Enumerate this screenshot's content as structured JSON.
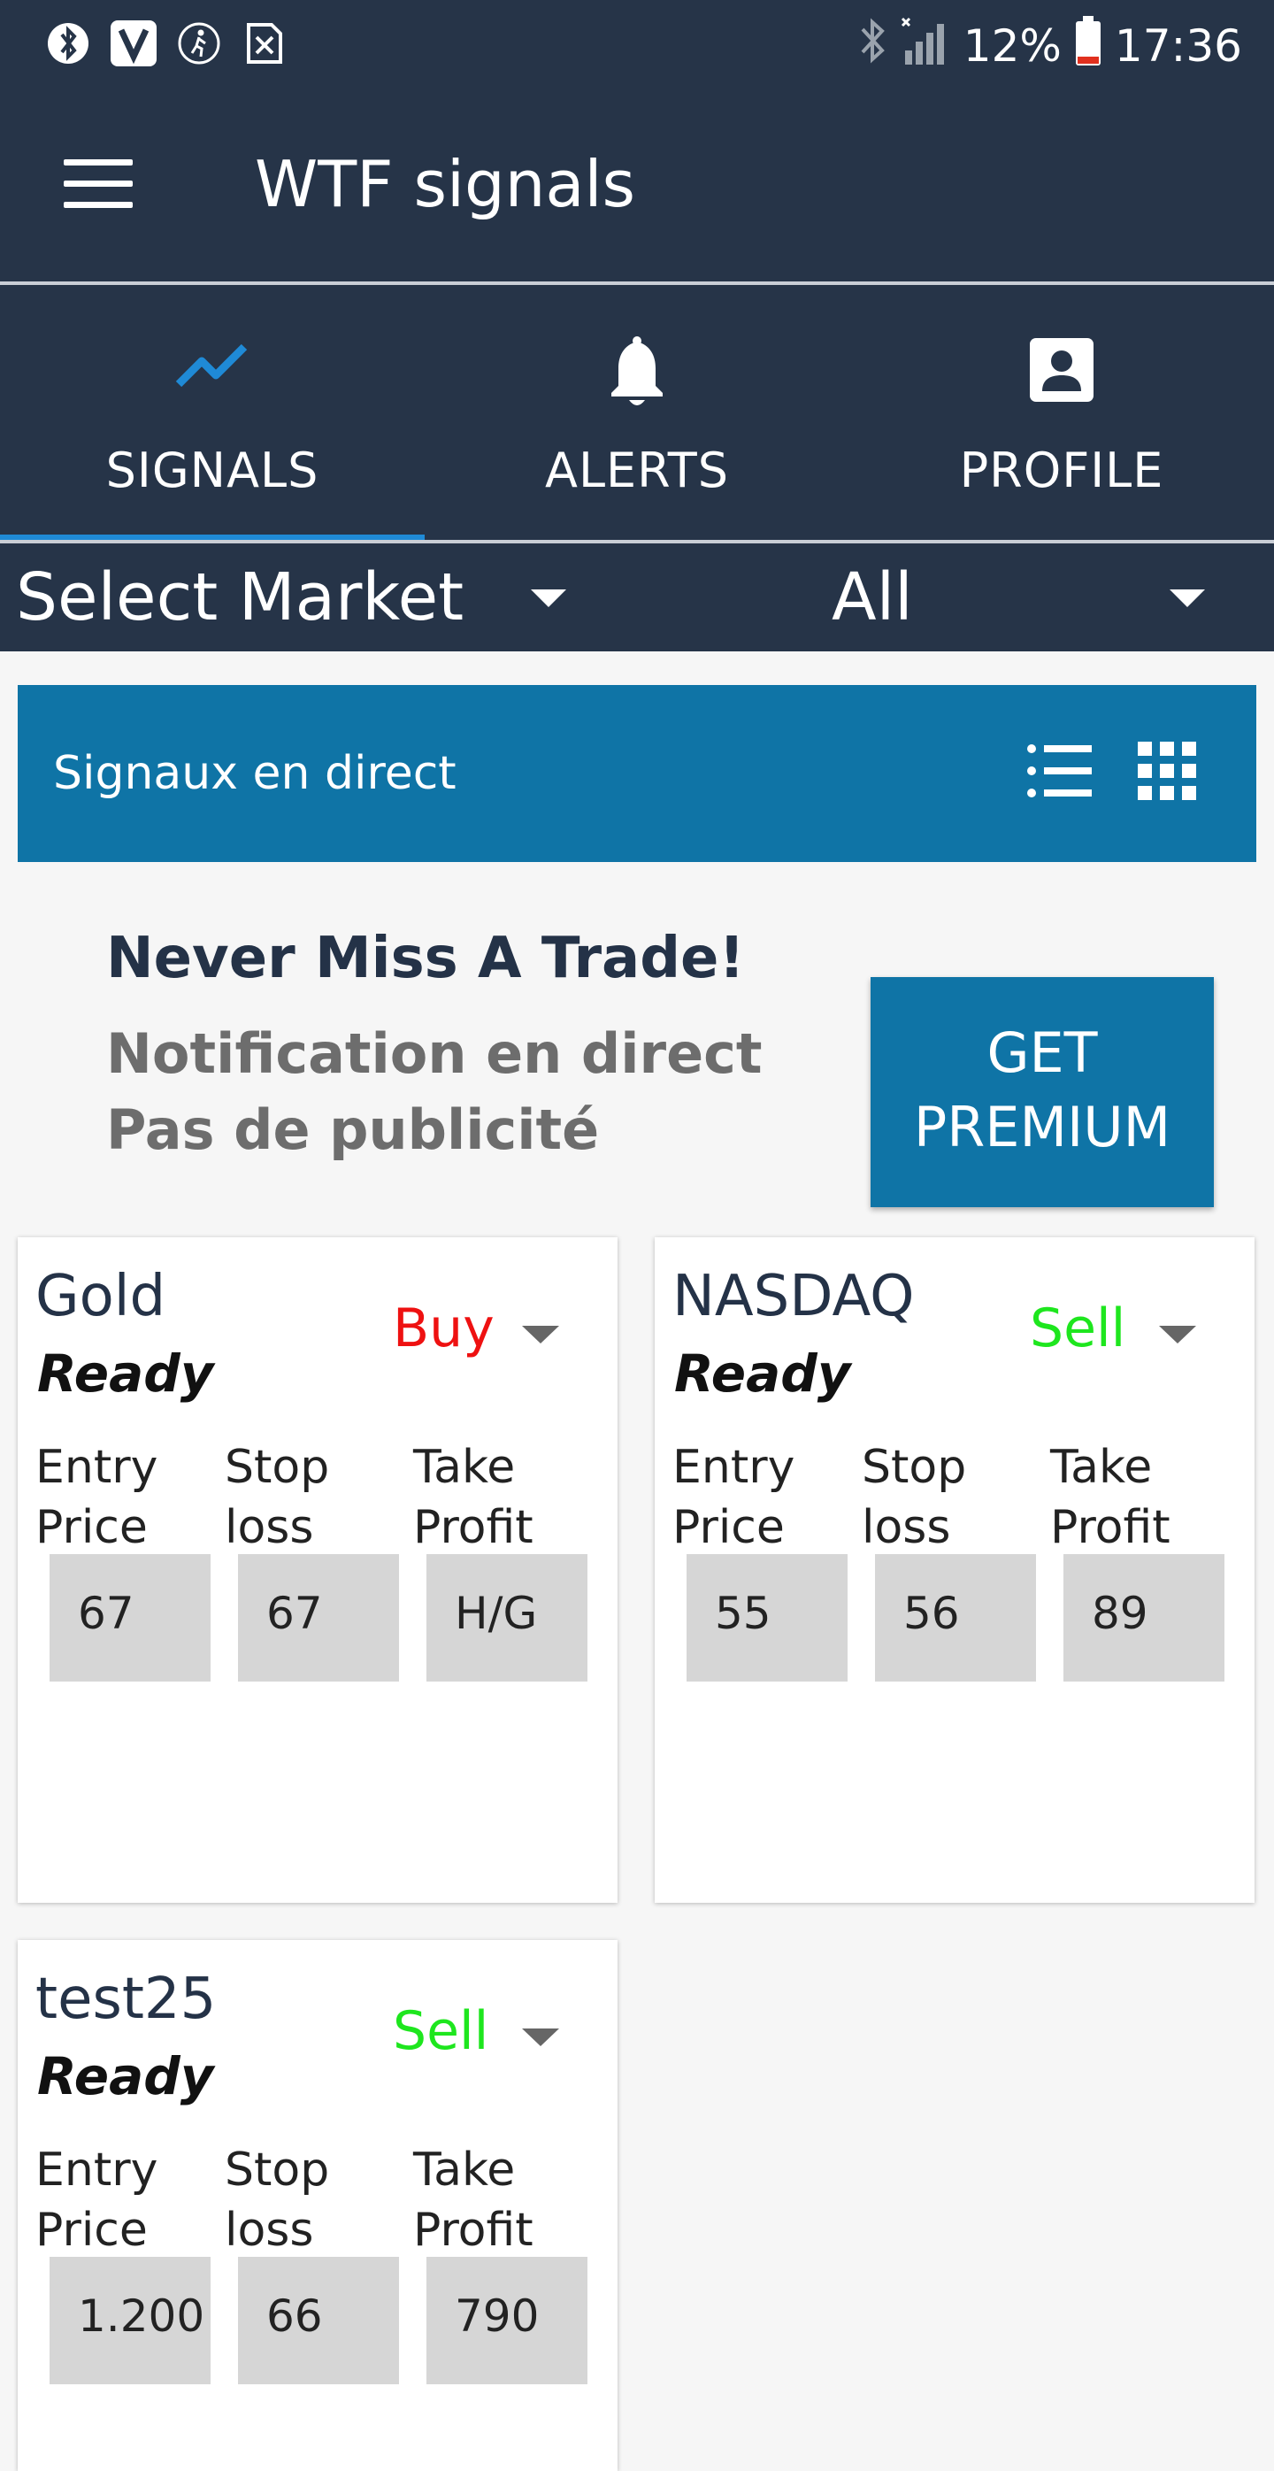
{
  "status_bar": {
    "battery": "12%",
    "time": "17:36",
    "left_icons": [
      "bluetooth-notification-icon",
      "v-app-icon",
      "activity-icon",
      "sim-alert-icon"
    ],
    "right_icons": [
      "bluetooth-icon",
      "signal-icon",
      "battery-icon"
    ]
  },
  "app": {
    "title": "WTF signals",
    "menu_icon": "hamburger-menu-icon"
  },
  "tabs": [
    {
      "label": "SIGNALS",
      "icon": "trending-icon",
      "active": true
    },
    {
      "label": "ALERTS",
      "icon": "bell-icon",
      "active": false
    },
    {
      "label": "PROFILE",
      "icon": "account-box-icon",
      "active": false
    }
  ],
  "filters": {
    "market": "Select Market",
    "category": "All"
  },
  "banner": {
    "label": "Signaux en direct",
    "list_icon": "list-view-icon",
    "grid_icon": "grid-view-icon"
  },
  "promo": {
    "title": "Never Miss A Trade!",
    "line1": "Notification en direct",
    "line2": "Pas de publicité",
    "button_line1": "GET",
    "button_line2": "PREMIUM"
  },
  "signal_columns": {
    "entry_line1": "Entry",
    "entry_line2": "Price",
    "stop_line1": "Stop",
    "stop_line2": "loss",
    "take_line1": "Take",
    "take_line2": "Profit"
  },
  "signals": [
    {
      "name": "Gold",
      "status": "Ready",
      "action": "Buy",
      "entry": "67",
      "stop": "67",
      "take": "H/G"
    },
    {
      "name": "NASDAQ",
      "status": "Ready",
      "action": "Sell",
      "entry": "55",
      "stop": "56",
      "take": "89"
    },
    {
      "name": "test25",
      "status": "Ready",
      "action": "Sell",
      "entry": "1.200",
      "stop": "66",
      "take": "790"
    }
  ],
  "colors": {
    "header_bg": "#263448",
    "accent_blue": "#0f74a6",
    "tab_indicator": "#1f8ad6",
    "buy": "#ee1111",
    "sell": "#1ee61e"
  }
}
